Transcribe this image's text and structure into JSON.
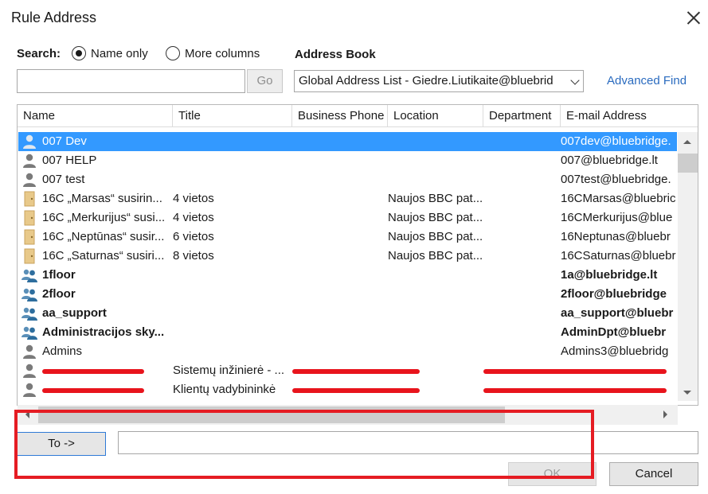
{
  "window": {
    "title": "Rule Address"
  },
  "search": {
    "label": "Search:",
    "option_name_only": "Name only",
    "option_more_columns": "More columns",
    "selected": "Name only",
    "input_value": "",
    "go_label": "Go"
  },
  "address_book": {
    "label": "Address Book",
    "selected": "Global Address List - Giedre.Liutikaite@bluebrid",
    "advanced_find": "Advanced Find"
  },
  "columns": [
    "Name",
    "Title",
    "Business Phone",
    "Location",
    "Department",
    "E-mail Address"
  ],
  "rows": [
    {
      "icon": "user-icon",
      "name": "007 Dev",
      "title": "",
      "phone": "",
      "location": "",
      "department": "",
      "email": "007dev@bluebridge.",
      "selected": true,
      "bold": false
    },
    {
      "icon": "user-icon",
      "name": "007 HELP",
      "title": "",
      "phone": "",
      "location": "",
      "department": "",
      "email": "007@bluebridge.lt",
      "selected": false,
      "bold": false
    },
    {
      "icon": "user-icon",
      "name": "007 test",
      "title": "",
      "phone": "",
      "location": "",
      "department": "",
      "email": "007test@bluebridge.",
      "selected": false,
      "bold": false
    },
    {
      "icon": "room-icon",
      "name": "16C „Marsas“ susirin...",
      "title": "4 vietos",
      "phone": "",
      "location": "Naujos BBC pat...",
      "department": "",
      "email": "16CMarsas@bluebric",
      "selected": false,
      "bold": false
    },
    {
      "icon": "room-icon",
      "name": "16C „Merkurijus“ susi...",
      "title": "4 vietos",
      "phone": "",
      "location": "Naujos BBC pat...",
      "department": "",
      "email": "16CMerkurijus@blue",
      "selected": false,
      "bold": false
    },
    {
      "icon": "room-icon",
      "name": "16C „Neptūnas“ susir...",
      "title": "6 vietos",
      "phone": "",
      "location": "Naujos BBC pat...",
      "department": "",
      "email": "16Neptunas@bluebr",
      "selected": false,
      "bold": false
    },
    {
      "icon": "room-icon",
      "name": "16C „Saturnas“ susiri...",
      "title": "8 vietos",
      "phone": "",
      "location": "Naujos BBC pat...",
      "department": "",
      "email": "16CSaturnas@bluebr",
      "selected": false,
      "bold": false
    },
    {
      "icon": "group-icon",
      "name": "1floor",
      "title": "",
      "phone": "",
      "location": "",
      "department": "",
      "email": "1a@bluebridge.lt",
      "selected": false,
      "bold": true
    },
    {
      "icon": "group-icon",
      "name": "2floor",
      "title": "",
      "phone": "",
      "location": "",
      "department": "",
      "email": "2floor@bluebridge",
      "selected": false,
      "bold": true
    },
    {
      "icon": "group-icon",
      "name": "aa_support",
      "title": "",
      "phone": "",
      "location": "",
      "department": "",
      "email": "aa_support@bluebr",
      "selected": false,
      "bold": true
    },
    {
      "icon": "group-icon",
      "name": "Administracijos sky...",
      "title": "",
      "phone": "",
      "location": "",
      "department": "",
      "email": "AdminDpt@bluebr",
      "selected": false,
      "bold": true
    },
    {
      "icon": "user-icon",
      "name": "Admins",
      "title": "",
      "phone": "",
      "location": "",
      "department": "",
      "email": "Admins3@bluebridg",
      "selected": false,
      "bold": false
    },
    {
      "icon": "user-icon",
      "name": "",
      "title": "Sistemų inžinierė - ...",
      "phone": "",
      "location": "",
      "department": "",
      "email": "",
      "selected": false,
      "bold": false,
      "redacted": true
    },
    {
      "icon": "user-icon",
      "name": "",
      "title": "Klientų vadybininkė",
      "phone": "",
      "location": "",
      "department": "",
      "email": "",
      "selected": false,
      "bold": false,
      "redacted": true
    }
  ],
  "recipient": {
    "to_label": "To ->",
    "to_value": ""
  },
  "buttons": {
    "ok": "OK",
    "cancel": "Cancel"
  },
  "colors": {
    "selection": "#3399ff",
    "link": "#2a6bbf",
    "highlight": "#e51c23",
    "redaction": "#e8141c"
  }
}
